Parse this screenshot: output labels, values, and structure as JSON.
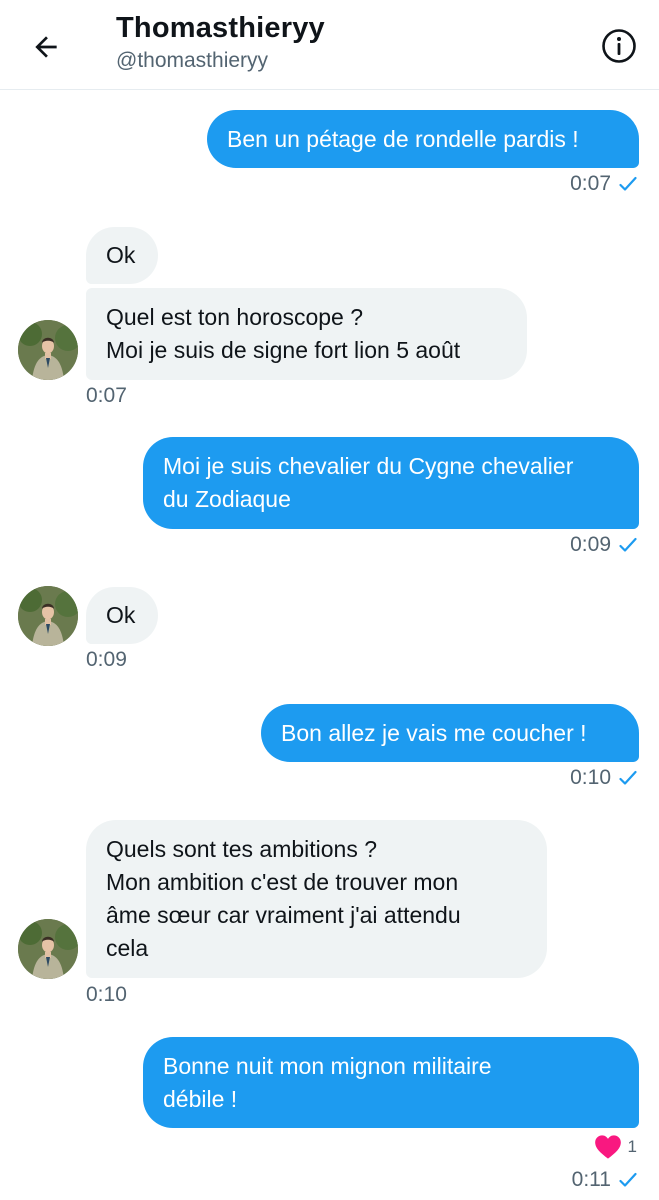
{
  "header": {
    "title": "Thomasthieryy",
    "handle": "@thomasthieryy"
  },
  "messages": [
    {
      "from": "me",
      "lines": [
        "Ben un pétage de rondelle pardis !"
      ],
      "time": "0:07"
    },
    {
      "from": "them",
      "lines": [
        "Ok"
      ]
    },
    {
      "from": "them",
      "lines": [
        "Quel est ton horoscope ?",
        "Moi je suis de signe fort lion 5 août"
      ],
      "time": "0:07"
    },
    {
      "from": "me",
      "lines": [
        "Moi je suis chevalier du Cygne chevalier",
        "du Zodiaque"
      ],
      "time": "0:09"
    },
    {
      "from": "them",
      "lines": [
        "Ok"
      ],
      "time": "0:09"
    },
    {
      "from": "me",
      "lines": [
        "Bon allez je vais me coucher !"
      ],
      "time": "0:10"
    },
    {
      "from": "them",
      "lines": [
        "Quels sont tes ambitions ?",
        "Mon ambition c'est de trouver mon",
        "âme sœur car vraiment j'ai attendu",
        "cela"
      ],
      "time": "0:10"
    },
    {
      "from": "me",
      "lines": [
        "Bonne nuit mon mignon militaire",
        "débile !"
      ],
      "time": "0:11",
      "reaction": {
        "icon": "heart-icon",
        "count": "1"
      }
    }
  ],
  "colors": {
    "accent": "#1d9bf0",
    "incoming": "#eff3f4",
    "heart": "#f91880"
  }
}
